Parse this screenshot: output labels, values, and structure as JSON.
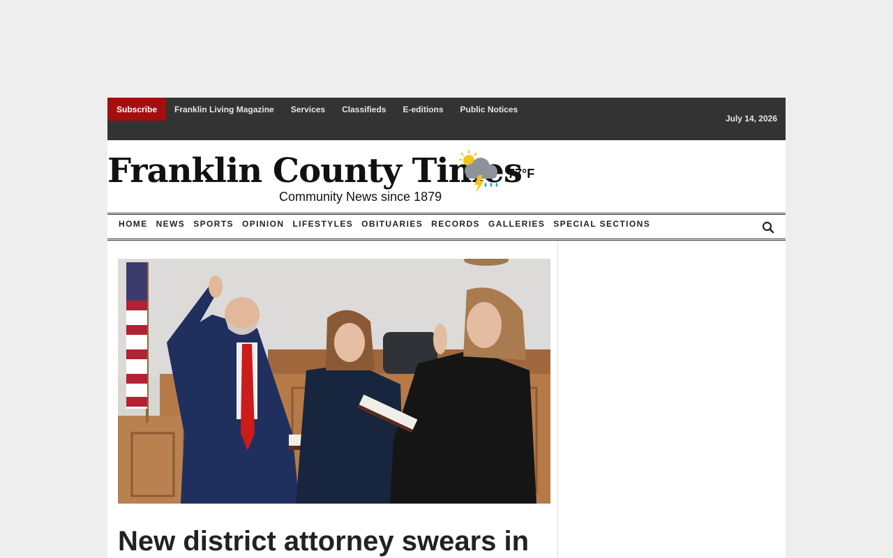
{
  "topbar": {
    "subscribe": "Subscribe",
    "links": [
      "Franklin Living Magazine",
      "Services",
      "Classifieds",
      "E-editions",
      "Public Notices"
    ],
    "date": "July 14, 2026"
  },
  "masthead": {
    "title": "Franklin County Times",
    "tagline": "Community News since 1879",
    "weather_icon": "thunderstorm-sun-icon",
    "temperature": "77°F"
  },
  "nav": {
    "items": [
      "HOME",
      "NEWS",
      "SPORTS",
      "OPINION",
      "LIFESTYLES",
      "OBITUARIES",
      "RECORDS",
      "GALLERIES",
      "SPECIAL SECTIONS"
    ],
    "search_icon": "search-icon"
  },
  "article": {
    "headline": "New district attorney swears in"
  },
  "colors": {
    "page_bg": "#eeeeee",
    "topbar_bg": "#333333",
    "subscribe_bg": "#a30f0f"
  }
}
